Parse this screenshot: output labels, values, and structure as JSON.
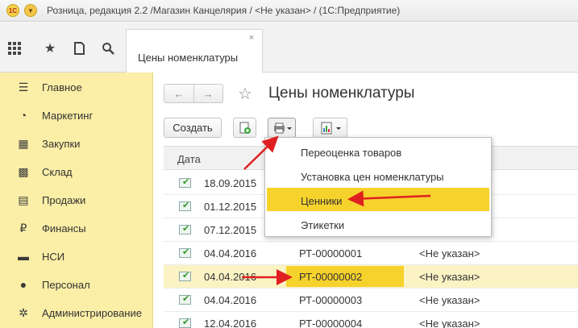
{
  "window": {
    "title": "Розница, редакция 2.2 /Магазин Канцелярия / <Не указан> /  (1С:Предприятие)",
    "logo": "1С"
  },
  "toolbar": {
    "icons": [
      "apps-grid-icon",
      "star-icon",
      "history-icon",
      "search-icon"
    ],
    "tab": {
      "label": "Цены номенклатуры",
      "close": "×"
    }
  },
  "sidebar": {
    "items": [
      {
        "label": "Главное",
        "icon": "menu-lines-icon",
        "glyph": "☰"
      },
      {
        "label": "Маркетинг",
        "icon": "pie-chart-icon",
        "glyph": "◔"
      },
      {
        "label": "Закупки",
        "icon": "cart-icon",
        "glyph": "▦"
      },
      {
        "label": "Склад",
        "icon": "warehouse-icon",
        "glyph": "▩"
      },
      {
        "label": "Продажи",
        "icon": "basket-icon",
        "glyph": "▤"
      },
      {
        "label": "Финансы",
        "icon": "ruble-icon",
        "glyph": "₽"
      },
      {
        "label": "НСИ",
        "icon": "folder-icon",
        "glyph": "▬"
      },
      {
        "label": "Персонал",
        "icon": "person-icon",
        "glyph": "●"
      },
      {
        "label": "Администрирование",
        "icon": "gear-icon",
        "glyph": "✲"
      }
    ]
  },
  "main": {
    "nav": {
      "back": "←",
      "forward": "→"
    },
    "star": "☆",
    "title": "Цены номенклатуры",
    "create_label": "Создать",
    "table": {
      "header_date": "Дата",
      "rows": [
        {
          "date": "18.09.2015",
          "number": "",
          "org": ""
        },
        {
          "date": "01.12.2015",
          "number": "",
          "org": ""
        },
        {
          "date": "07.12.2015",
          "number": "",
          "org": ""
        },
        {
          "date": "04.04.2016",
          "number": "РТ-00000001",
          "org": "<Не указан>"
        },
        {
          "date": "04.04.2016",
          "number": "РТ-00000002",
          "org": "<Не указан>"
        },
        {
          "date": "04.04.2016",
          "number": "РТ-00000003",
          "org": "<Не указан>"
        },
        {
          "date": "12.04.2016",
          "number": "РТ-00000004",
          "org": "<Не указан>"
        }
      ]
    },
    "print_menu": [
      "Переоценка товаров",
      "Установка цен номенклатуры",
      "Ценники",
      "Этикетки"
    ]
  },
  "colors": {
    "sidebar_bg": "#fbeea6",
    "highlight": "#f6d22c",
    "arrow": "#e02020"
  }
}
